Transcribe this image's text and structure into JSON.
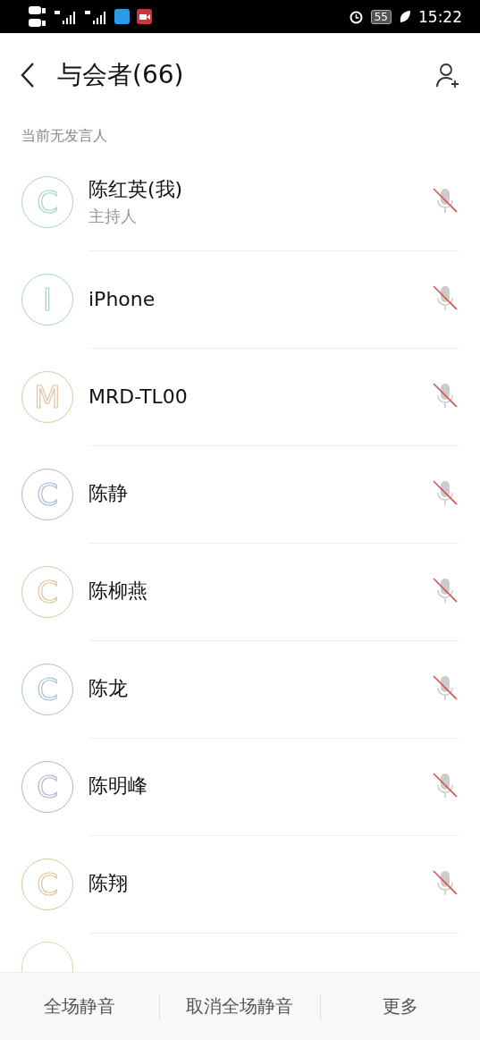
{
  "status_bar": {
    "battery": "55",
    "time": "15:22"
  },
  "header": {
    "title": "与会者(66)"
  },
  "section_label": "当前无发言人",
  "participants": [
    {
      "kind": "full",
      "initial": "C",
      "color": "#a6d8b6",
      "name": "陈红英(我)",
      "role": "主持人",
      "muted": true
    },
    {
      "kind": "full",
      "initial": "I",
      "color": "#a6d8b6",
      "name": "iPhone",
      "muted": true
    },
    {
      "kind": "full",
      "initial": "M",
      "color": "#dcc6a0",
      "name": "MRD-TL00",
      "muted": true
    },
    {
      "kind": "full",
      "initial": "C",
      "color": "#a8bcd2",
      "name": "陈静",
      "muted": true
    },
    {
      "kind": "full",
      "initial": "C",
      "color": "#dcc6a0",
      "name": "陈柳燕",
      "muted": true
    },
    {
      "kind": "full",
      "initial": "C",
      "color": "#a6c4d2",
      "name": "陈龙",
      "muted": true
    },
    {
      "kind": "full",
      "initial": "C",
      "color": "#bbb0d2",
      "name": "陈明峰",
      "muted": true
    },
    {
      "kind": "full",
      "initial": "C",
      "color": "#dcc69c",
      "name": "陈翔",
      "muted": true
    },
    {
      "kind": "partial",
      "color": "#e0d6a6"
    }
  ],
  "toolbar": [
    "全场静音",
    "取消全场静音",
    "更多"
  ]
}
